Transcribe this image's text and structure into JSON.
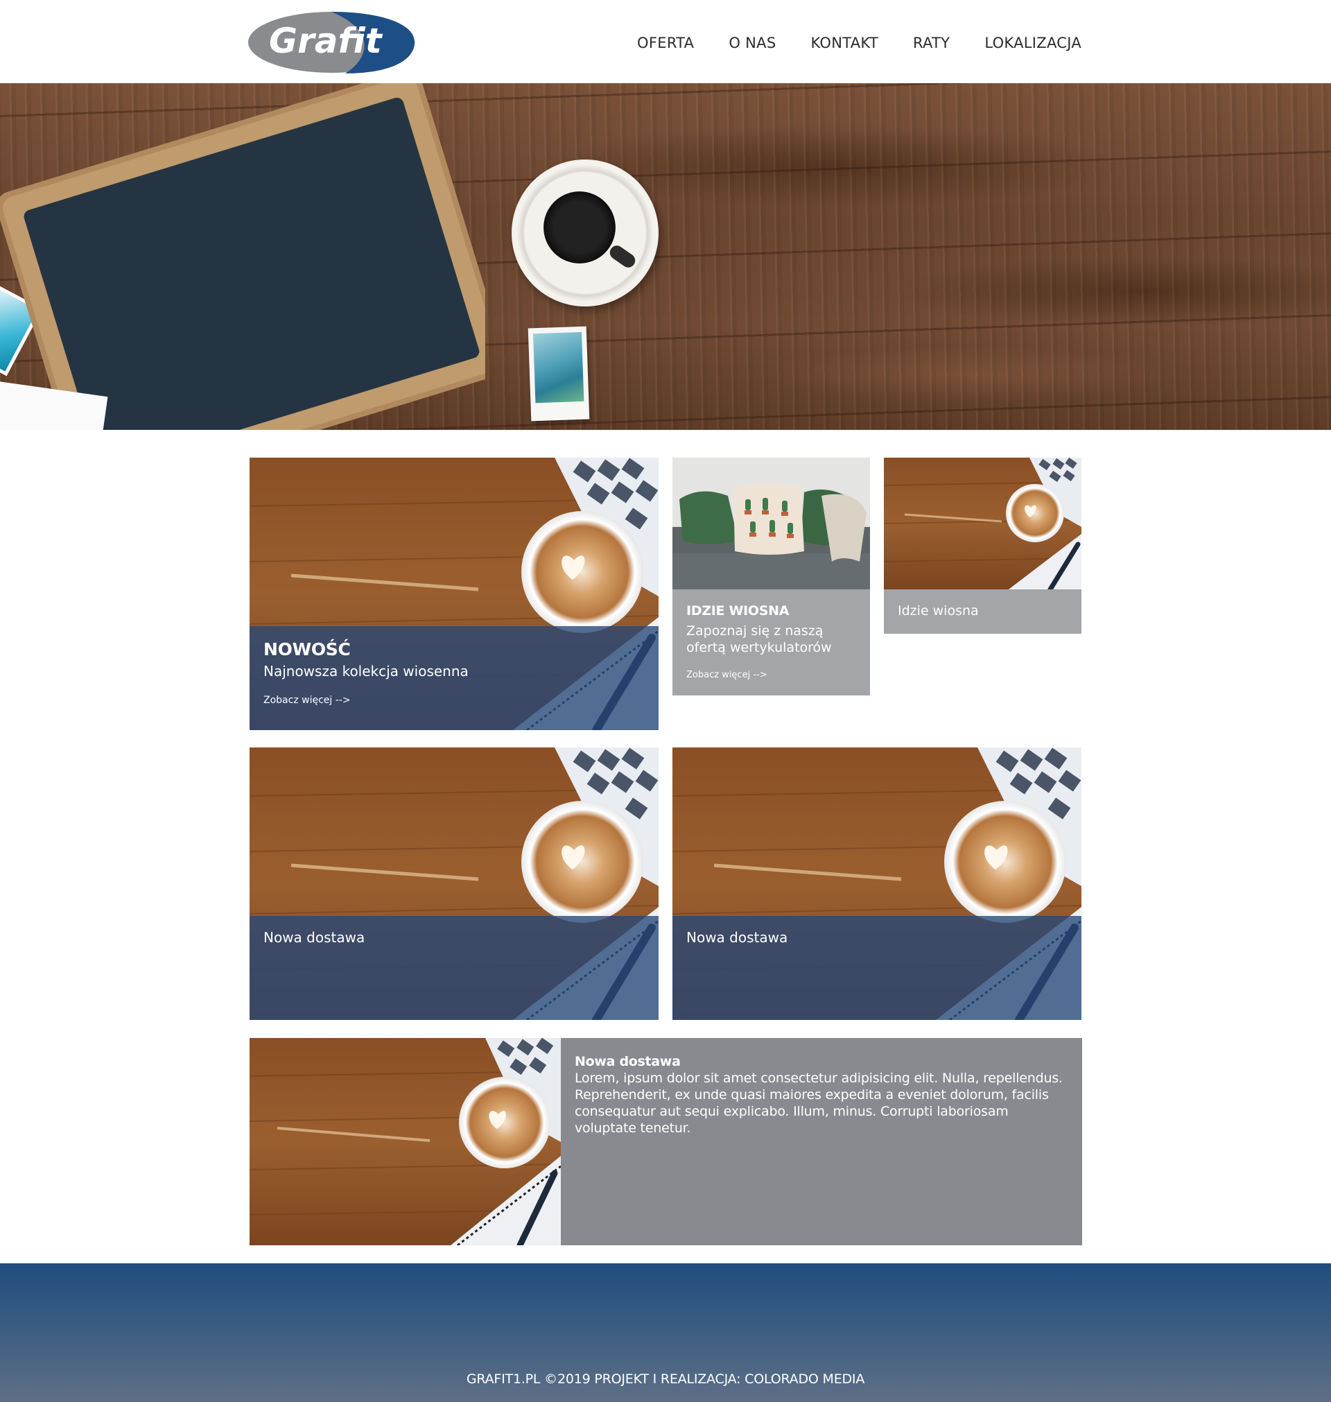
{
  "brand": {
    "logo_text": "Grafit",
    "logo_colors": {
      "gray": "#8a8b8f",
      "blue": "#1e4e86"
    }
  },
  "nav": {
    "items": [
      {
        "label": "OFERTA"
      },
      {
        "label": "O NAS"
      },
      {
        "label": "KONTAKT"
      },
      {
        "label": "RATY"
      },
      {
        "label": "LOKALIZACJA"
      }
    ]
  },
  "tiles": {
    "feature": {
      "title": "NOWOŚĆ",
      "subtitle": "Najnowsza kolekcja wiosenna",
      "more": "Zobacz więcej -->"
    },
    "spring": {
      "title": "IDZIE WIOSNA",
      "subtitle": "Zapoznaj się z naszą ofertą wertykulatorów",
      "more": "Zobacz więcej -->"
    },
    "spring_small": {
      "label": "Idzie wiosna"
    },
    "delivery_left": {
      "label": "Nowa dostawa"
    },
    "delivery_right": {
      "label": "Nowa dostawa"
    },
    "wide": {
      "title": "Nowa dostawa",
      "body": "Lorem, ipsum dolor sit amet consectetur adipisicing elit. Nulla, repellendus. Reprehenderit, ex unde quasi maiores expedita a eveniet dolorum, facilis consequatur aut sequi explicabo. Illum, minus. Corrupti laboriosam voluptate tenetur."
    }
  },
  "footer": {
    "text": "GRAFIT1.PL ©2019 PROJEKT I REALIZACJA: COLORADO MEDIA"
  },
  "colors": {
    "accent_blue": "#264878",
    "gray_panel": "#a4a5a9",
    "wide_gray": "#898a8f"
  }
}
